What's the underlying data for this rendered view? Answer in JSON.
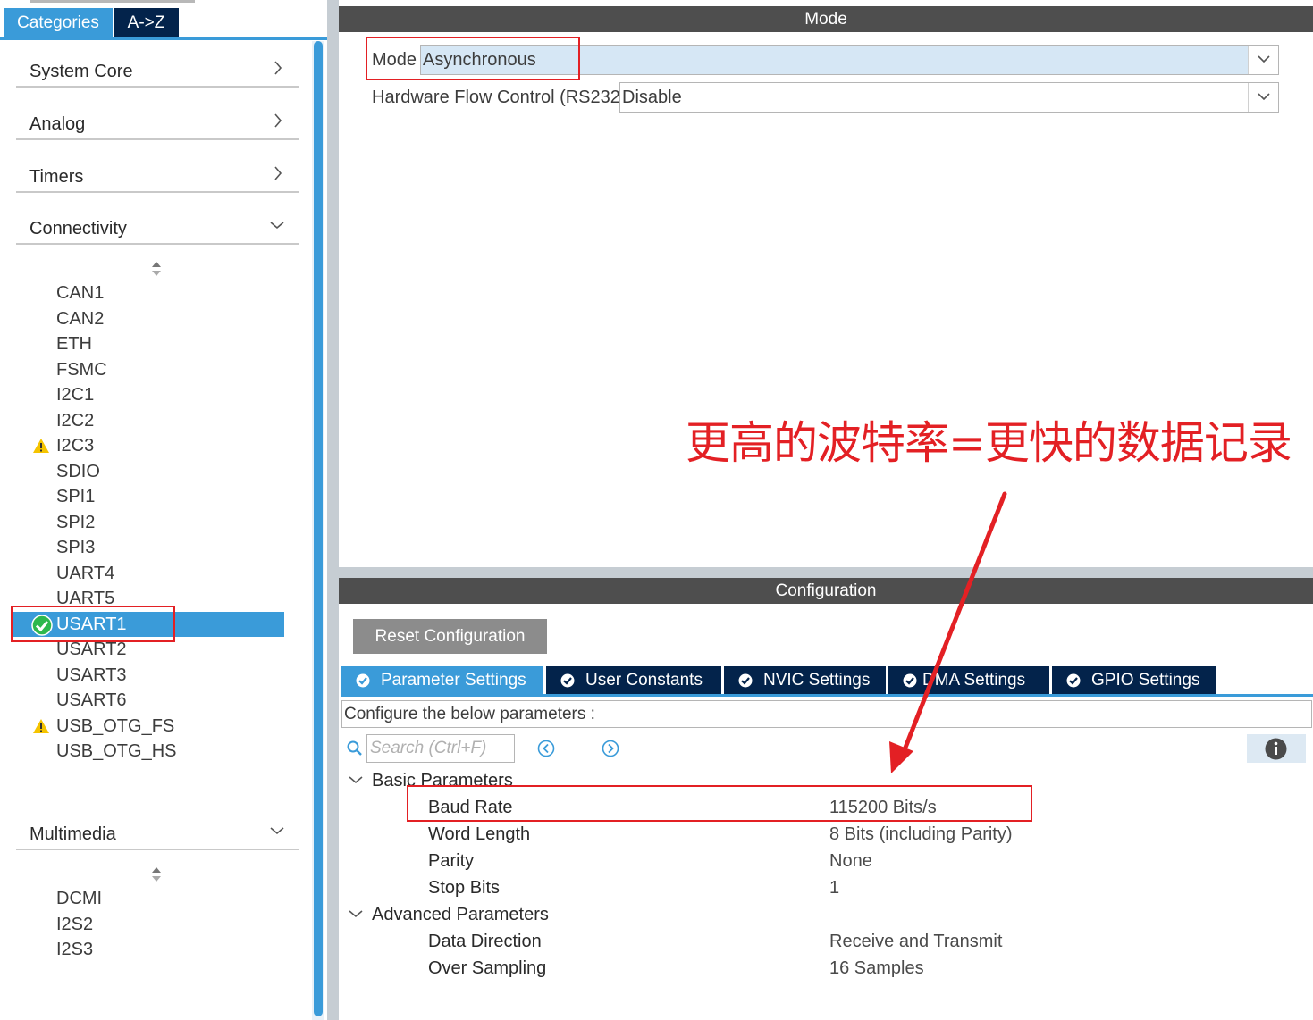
{
  "left_panel": {
    "tabs": {
      "categories": "Categories",
      "az": "A->Z"
    },
    "groups": {
      "system_core": "System Core",
      "analog": "Analog",
      "timers": "Timers",
      "connectivity": "Connectivity",
      "multimedia": "Multimedia"
    },
    "connectivity_items": [
      {
        "label": "CAN1",
        "status": ""
      },
      {
        "label": "CAN2",
        "status": ""
      },
      {
        "label": "ETH",
        "status": ""
      },
      {
        "label": "FSMC",
        "status": ""
      },
      {
        "label": "I2C1",
        "status": ""
      },
      {
        "label": "I2C2",
        "status": ""
      },
      {
        "label": "I2C3",
        "status": "warning"
      },
      {
        "label": "SDIO",
        "status": ""
      },
      {
        "label": "SPI1",
        "status": ""
      },
      {
        "label": "SPI2",
        "status": ""
      },
      {
        "label": "SPI3",
        "status": ""
      },
      {
        "label": "UART4",
        "status": ""
      },
      {
        "label": "UART5",
        "status": ""
      },
      {
        "label": "USART1",
        "status": "ok",
        "selected": true
      },
      {
        "label": "USART2",
        "status": ""
      },
      {
        "label": "USART3",
        "status": ""
      },
      {
        "label": "USART6",
        "status": ""
      },
      {
        "label": "USB_OTG_FS",
        "status": "warning"
      },
      {
        "label": "USB_OTG_HS",
        "status": ""
      }
    ],
    "multimedia_items": [
      {
        "label": "DCMI"
      },
      {
        "label": "I2S2"
      },
      {
        "label": "I2S3"
      }
    ]
  },
  "mode_section": {
    "title": "Mode",
    "mode_label": "Mode",
    "mode_value": "Asynchronous",
    "flow_label": "Hardware Flow Control (RS232)",
    "flow_value": "Disable"
  },
  "config_section": {
    "title": "Configuration",
    "reset_label": "Reset Configuration",
    "tabs": [
      {
        "label": "Parameter Settings",
        "active": true
      },
      {
        "label": "User Constants"
      },
      {
        "label": "NVIC Settings"
      },
      {
        "label": "DMA Settings"
      },
      {
        "label": "GPIO Settings"
      }
    ],
    "configure_text": "Configure the below parameters :",
    "search_placeholder": "Search (Ctrl+F)",
    "basic_params_label": "Basic Parameters",
    "basic_params": [
      {
        "name": "Baud Rate",
        "value": "115200 Bits/s"
      },
      {
        "name": "Word Length",
        "value": "8 Bits (including Parity)"
      },
      {
        "name": "Parity",
        "value": "None"
      },
      {
        "name": "Stop Bits",
        "value": "1"
      }
    ],
    "advanced_params_label": "Advanced Parameters",
    "advanced_params": [
      {
        "name": "Data Direction",
        "value": "Receive and Transmit"
      },
      {
        "name": "Over Sampling",
        "value": "16 Samples"
      }
    ]
  },
  "annotation": {
    "text": "更高的波特率=更快的数据记录",
    "color": "#e32024"
  },
  "colors": {
    "accent": "#3a9bd9",
    "dark_navy": "#03234b",
    "section_bar": "#4e4e4e",
    "warning": "#f5c400",
    "ok": "#2db84d"
  }
}
